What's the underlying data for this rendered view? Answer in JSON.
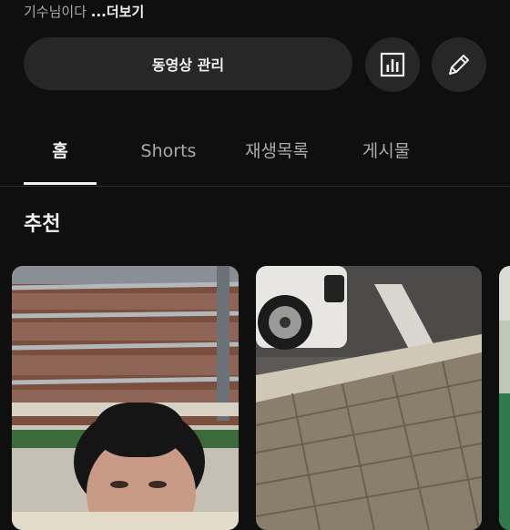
{
  "channel": {
    "description_snippet": "기수님이다 ",
    "more_label": "...더보기"
  },
  "actions": {
    "manage_videos_label": "동영상 관리",
    "analytics_icon": "bar-chart-icon",
    "edit_icon": "pencil-icon"
  },
  "tabs": [
    {
      "label": "홈",
      "active": true
    },
    {
      "label": "Shorts",
      "active": false
    },
    {
      "label": "재생목록",
      "active": false
    },
    {
      "label": "게시물",
      "active": false
    }
  ],
  "section": {
    "title": "추천"
  },
  "colors": {
    "background": "#0f0f0f",
    "button_bg": "#272727",
    "text_primary": "#f1f1f1",
    "text_secondary": "#aaaaaa"
  }
}
